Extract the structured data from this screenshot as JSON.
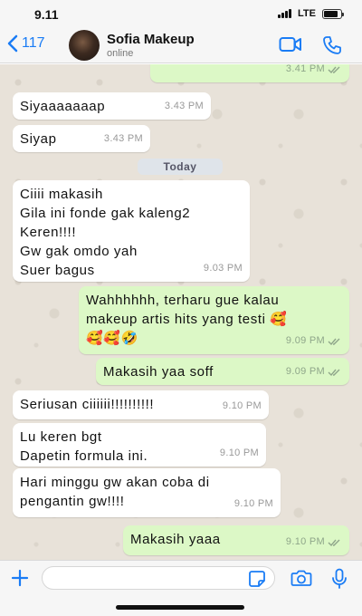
{
  "status_bar": {
    "time": "9.11",
    "network": "LTE",
    "battery_level": 0.85
  },
  "header": {
    "back_count": "117",
    "contact_name": "Sofia Makeup",
    "contact_status": "online",
    "icons": [
      "chevron-left-icon",
      "video-call-icon",
      "phone-icon"
    ]
  },
  "messages": [
    {
      "direction": "out",
      "text": "",
      "time": "3.41 PM",
      "read": true
    },
    {
      "direction": "in",
      "lines": [
        "Siyaaaaaaap"
      ],
      "time": "3.43 PM"
    },
    {
      "direction": "in",
      "lines": [
        "Siyap"
      ],
      "time": "3.43 PM"
    },
    {
      "direction": "in",
      "lines": [
        "Ciiii makasih",
        "Gila ini fonde gak kaleng2",
        "Keren!!!!",
        "Gw gak omdo yah",
        "Suer bagus"
      ],
      "time": "9.03 PM"
    },
    {
      "direction": "out",
      "lines": [
        "Wahhhhhh, terharu gue kalau",
        "makeup artis hits yang testi 🥰",
        "🥰🥰🤣"
      ],
      "time": "9.09 PM",
      "read": true
    },
    {
      "direction": "out",
      "lines": [
        "Makasih yaa soff"
      ],
      "time": "9.09 PM",
      "read": true
    },
    {
      "direction": "in",
      "lines": [
        "Seriusan ciiiiii!!!!!!!!!!"
      ],
      "time": "9.10 PM"
    },
    {
      "direction": "in",
      "lines": [
        "Lu keren bgt",
        "Dapetin formula ini."
      ],
      "time": "9.10 PM"
    },
    {
      "direction": "in",
      "lines": [
        "Hari minggu gw akan coba di",
        "pengantin gw!!!!"
      ],
      "time": "9.10 PM"
    },
    {
      "direction": "out",
      "lines": [
        "Makasih yaaa"
      ],
      "time": "9.10 PM",
      "read": true
    }
  ],
  "date_separator": "Today",
  "input": {
    "placeholder": ""
  },
  "colors": {
    "accent": "#1a7cf5",
    "incoming": "#ffffff",
    "outgoing": "#dcf8c6",
    "read_ticks": "#8fa68a"
  }
}
